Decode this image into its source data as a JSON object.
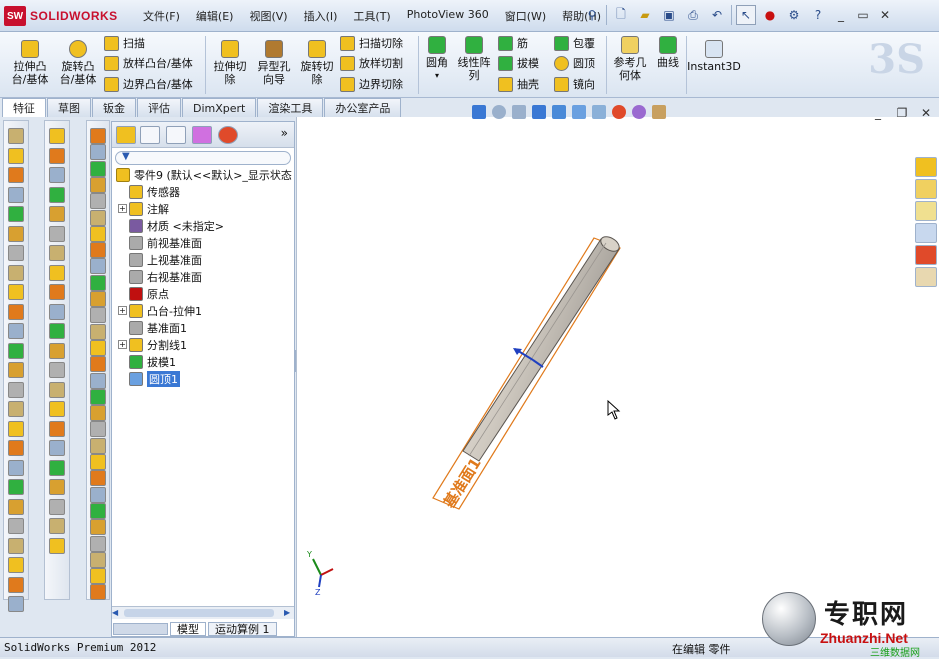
{
  "app": {
    "brand": "SOLIDWORKS",
    "brand_mark": "SW"
  },
  "menu": [
    "文件(F)",
    "编辑(E)",
    "视图(V)",
    "插入(I)",
    "工具(T)",
    "PhotoView 360",
    "窗口(W)",
    "帮助(H)"
  ],
  "ribbon": {
    "extrude_boss": "拉伸凸\n台/基体",
    "revolve_boss": "旋转凸\n台/基体",
    "sweep": "扫描",
    "loft": "放样凸台/基体",
    "boundary_boss": "边界凸台/基体",
    "extrude_cut": "拉伸切\n除",
    "hole_wizard": "异型孔\n向导",
    "revolve_cut": "旋转切\n除",
    "sweep_cut": "扫描切除",
    "loft_cut": "放样切割",
    "boundary_cut": "边界切除",
    "fillet": "圆角",
    "linear_pattern": "线性阵\n列",
    "rib": "筋",
    "draft": "拔模",
    "shell": "抽壳",
    "wrap": "包覆",
    "dome": "圆顶",
    "mirror": "镜向",
    "ref_geometry": "参考几\n何体",
    "curves": "曲线",
    "instant3d": "Instant3D"
  },
  "tabs": [
    "特征",
    "草图",
    "钣金",
    "评估",
    "DimXpert",
    "渲染工具",
    "办公室产品"
  ],
  "tree": {
    "root": "零件9  (默认<<默认>_显示状态",
    "items": [
      {
        "label": "传感器",
        "expand": false
      },
      {
        "label": "注解",
        "expand": true
      },
      {
        "label": "材质 <未指定>",
        "expand": false
      },
      {
        "label": "前视基准面",
        "expand": false
      },
      {
        "label": "上视基准面",
        "expand": false
      },
      {
        "label": "右视基准面",
        "expand": false
      },
      {
        "label": "原点",
        "expand": false
      },
      {
        "label": "凸台-拉伸1",
        "expand": true
      },
      {
        "label": "基准面1",
        "expand": false
      },
      {
        "label": "分割线1",
        "expand": true
      },
      {
        "label": "拔模1",
        "expand": false
      },
      {
        "label": "圆顶1",
        "expand": false,
        "selected": true
      }
    ]
  },
  "bottom_tabs": [
    "模型",
    "运动算例 1"
  ],
  "viewport": {
    "plane_label": "基准面1"
  },
  "status": {
    "left": "SolidWorks Premium 2012",
    "right": "在编辑 零件"
  },
  "watermark": {
    "cn": "专职网",
    "en": "Zhuanzhi.Net",
    "cn2": "三维数据网"
  },
  "colors": {
    "accent": "#c8102e",
    "selection": "#3a78d4",
    "plane": "#e07a1c"
  }
}
